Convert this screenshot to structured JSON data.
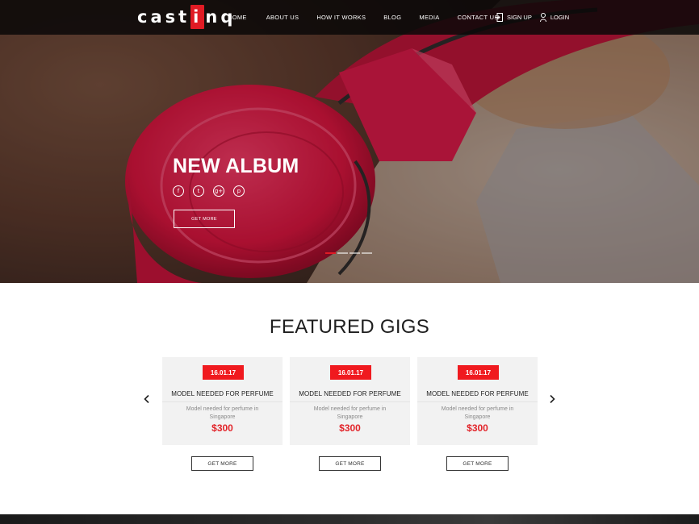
{
  "brand": {
    "pre": "cast",
    "mark": "i",
    "post": "nq"
  },
  "nav": {
    "items": [
      "HOME",
      "ABOUT US",
      "HOW IT WORKS",
      "BLOG",
      "MEDIA",
      "CONTACT US"
    ],
    "signup": "SIGN UP",
    "login": "LOGIN"
  },
  "hero": {
    "title": "NEW ALBUM",
    "socials": [
      "f",
      "t",
      "g+",
      "p"
    ],
    "button": "GET MORE",
    "slides": 4,
    "active_slide": 1
  },
  "featured": {
    "title": "FEATURED GIGS",
    "gigs": [
      {
        "date": "16.01.17",
        "title": "MODEL NEEDED FOR PERFUME",
        "desc_1": "Model needed for perfume in",
        "desc_2": "Singapore",
        "price": "$300",
        "button": "GET MORE"
      },
      {
        "date": "16.01.17",
        "title": "MODEL NEEDED FOR PERFUME",
        "desc_1": "Model needed for perfume in",
        "desc_2": "Singapore",
        "price": "$300",
        "button": "GET MORE"
      },
      {
        "date": "16.01.17",
        "title": "MODEL NEEDED FOR PERFUME",
        "desc_1": "Model needed for perfume in",
        "desc_2": "Singapore",
        "price": "$300",
        "button": "GET MORE"
      }
    ]
  },
  "colors": {
    "accent": "#e01b24",
    "nav_bg": "#0a0808",
    "card_bg": "#f2f2f2",
    "price": "#e2242a"
  },
  "icons": {
    "signup": "sign-in-icon",
    "login": "user-icon",
    "prev": "chevron-left-icon",
    "next": "chevron-right-icon"
  }
}
